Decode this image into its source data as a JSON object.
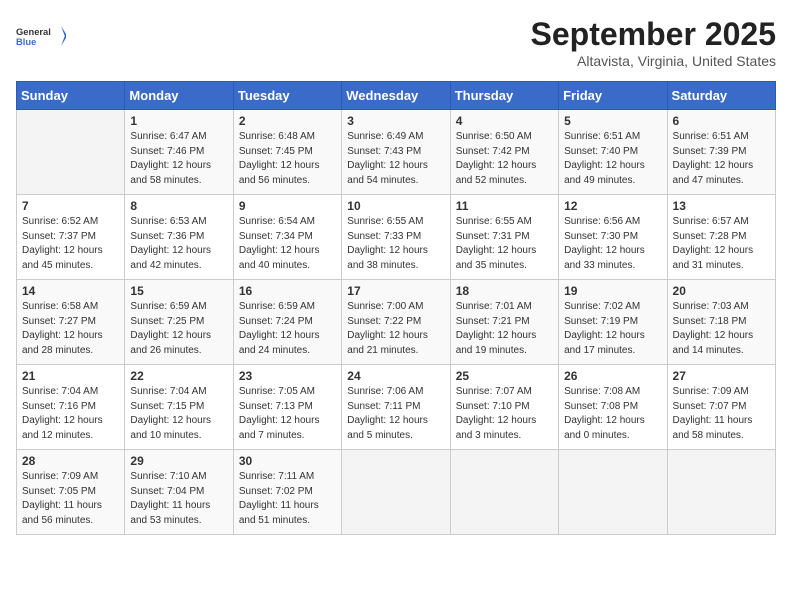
{
  "logo": {
    "line1": "General",
    "line2": "Blue"
  },
  "title": "September 2025",
  "location": "Altavista, Virginia, United States",
  "days_of_week": [
    "Sunday",
    "Monday",
    "Tuesday",
    "Wednesday",
    "Thursday",
    "Friday",
    "Saturday"
  ],
  "weeks": [
    [
      {
        "day": "",
        "info": ""
      },
      {
        "day": "1",
        "info": "Sunrise: 6:47 AM\nSunset: 7:46 PM\nDaylight: 12 hours\nand 58 minutes."
      },
      {
        "day": "2",
        "info": "Sunrise: 6:48 AM\nSunset: 7:45 PM\nDaylight: 12 hours\nand 56 minutes."
      },
      {
        "day": "3",
        "info": "Sunrise: 6:49 AM\nSunset: 7:43 PM\nDaylight: 12 hours\nand 54 minutes."
      },
      {
        "day": "4",
        "info": "Sunrise: 6:50 AM\nSunset: 7:42 PM\nDaylight: 12 hours\nand 52 minutes."
      },
      {
        "day": "5",
        "info": "Sunrise: 6:51 AM\nSunset: 7:40 PM\nDaylight: 12 hours\nand 49 minutes."
      },
      {
        "day": "6",
        "info": "Sunrise: 6:51 AM\nSunset: 7:39 PM\nDaylight: 12 hours\nand 47 minutes."
      }
    ],
    [
      {
        "day": "7",
        "info": "Sunrise: 6:52 AM\nSunset: 7:37 PM\nDaylight: 12 hours\nand 45 minutes."
      },
      {
        "day": "8",
        "info": "Sunrise: 6:53 AM\nSunset: 7:36 PM\nDaylight: 12 hours\nand 42 minutes."
      },
      {
        "day": "9",
        "info": "Sunrise: 6:54 AM\nSunset: 7:34 PM\nDaylight: 12 hours\nand 40 minutes."
      },
      {
        "day": "10",
        "info": "Sunrise: 6:55 AM\nSunset: 7:33 PM\nDaylight: 12 hours\nand 38 minutes."
      },
      {
        "day": "11",
        "info": "Sunrise: 6:55 AM\nSunset: 7:31 PM\nDaylight: 12 hours\nand 35 minutes."
      },
      {
        "day": "12",
        "info": "Sunrise: 6:56 AM\nSunset: 7:30 PM\nDaylight: 12 hours\nand 33 minutes."
      },
      {
        "day": "13",
        "info": "Sunrise: 6:57 AM\nSunset: 7:28 PM\nDaylight: 12 hours\nand 31 minutes."
      }
    ],
    [
      {
        "day": "14",
        "info": "Sunrise: 6:58 AM\nSunset: 7:27 PM\nDaylight: 12 hours\nand 28 minutes."
      },
      {
        "day": "15",
        "info": "Sunrise: 6:59 AM\nSunset: 7:25 PM\nDaylight: 12 hours\nand 26 minutes."
      },
      {
        "day": "16",
        "info": "Sunrise: 6:59 AM\nSunset: 7:24 PM\nDaylight: 12 hours\nand 24 minutes."
      },
      {
        "day": "17",
        "info": "Sunrise: 7:00 AM\nSunset: 7:22 PM\nDaylight: 12 hours\nand 21 minutes."
      },
      {
        "day": "18",
        "info": "Sunrise: 7:01 AM\nSunset: 7:21 PM\nDaylight: 12 hours\nand 19 minutes."
      },
      {
        "day": "19",
        "info": "Sunrise: 7:02 AM\nSunset: 7:19 PM\nDaylight: 12 hours\nand 17 minutes."
      },
      {
        "day": "20",
        "info": "Sunrise: 7:03 AM\nSunset: 7:18 PM\nDaylight: 12 hours\nand 14 minutes."
      }
    ],
    [
      {
        "day": "21",
        "info": "Sunrise: 7:04 AM\nSunset: 7:16 PM\nDaylight: 12 hours\nand 12 minutes."
      },
      {
        "day": "22",
        "info": "Sunrise: 7:04 AM\nSunset: 7:15 PM\nDaylight: 12 hours\nand 10 minutes."
      },
      {
        "day": "23",
        "info": "Sunrise: 7:05 AM\nSunset: 7:13 PM\nDaylight: 12 hours\nand 7 minutes."
      },
      {
        "day": "24",
        "info": "Sunrise: 7:06 AM\nSunset: 7:11 PM\nDaylight: 12 hours\nand 5 minutes."
      },
      {
        "day": "25",
        "info": "Sunrise: 7:07 AM\nSunset: 7:10 PM\nDaylight: 12 hours\nand 3 minutes."
      },
      {
        "day": "26",
        "info": "Sunrise: 7:08 AM\nSunset: 7:08 PM\nDaylight: 12 hours\nand 0 minutes."
      },
      {
        "day": "27",
        "info": "Sunrise: 7:09 AM\nSunset: 7:07 PM\nDaylight: 11 hours\nand 58 minutes."
      }
    ],
    [
      {
        "day": "28",
        "info": "Sunrise: 7:09 AM\nSunset: 7:05 PM\nDaylight: 11 hours\nand 56 minutes."
      },
      {
        "day": "29",
        "info": "Sunrise: 7:10 AM\nSunset: 7:04 PM\nDaylight: 11 hours\nand 53 minutes."
      },
      {
        "day": "30",
        "info": "Sunrise: 7:11 AM\nSunset: 7:02 PM\nDaylight: 11 hours\nand 51 minutes."
      },
      {
        "day": "",
        "info": ""
      },
      {
        "day": "",
        "info": ""
      },
      {
        "day": "",
        "info": ""
      },
      {
        "day": "",
        "info": ""
      }
    ]
  ]
}
